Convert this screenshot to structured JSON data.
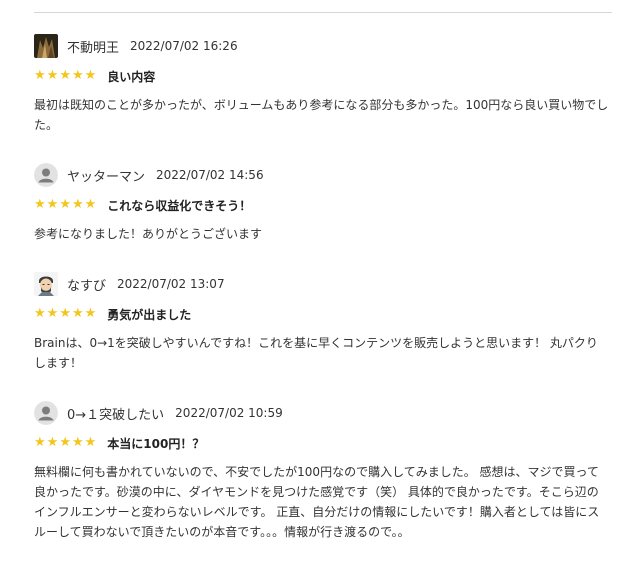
{
  "reviews": [
    {
      "user": "不動明王",
      "date": "2022/07/02 16:26",
      "avatar_icon": "photo-avatar-icon",
      "rating": 5,
      "title": "良い内容",
      "body": "最初は既知のことが多かったが、ボリュームもあり参考になる部分も多かった。100円なら良い買い物でした。"
    },
    {
      "user": "ヤッターマン",
      "date": "2022/07/02 14:56",
      "avatar_icon": "default-user-icon",
      "rating": 5,
      "title": "これなら収益化できそう！",
      "body": "参考になりました！ありがとうございます"
    },
    {
      "user": "なすび",
      "date": "2022/07/02 13:07",
      "avatar_icon": "illustration-avatar-icon",
      "rating": 5,
      "title": "勇気が出ました",
      "body": "Brainは、0→1を突破しやすいんですね！これを基に早くコンテンツを販売しようと思います！ 丸パクりします！"
    },
    {
      "user": "0→１突破したい",
      "date": "2022/07/02 10:59",
      "avatar_icon": "default-user-icon",
      "rating": 5,
      "title": "本当に100円！？",
      "body": "無料欄に何も書かれていないので、不安でしたが100円なので購入してみました。 感想は、マジで買って良かったです。砂漠の中に、ダイヤモンドを見つけた感覚です（笑） 具体的で良かったです。そこら辺のインフルエンサーと変わらないレベルです。 正直、自分だけの情報にしたいです！購入者としては皆にスルーして買わないで頂きたいのが本音です。。。情報が行き渡るので。。"
    }
  ],
  "star_color": "#f3c61d"
}
